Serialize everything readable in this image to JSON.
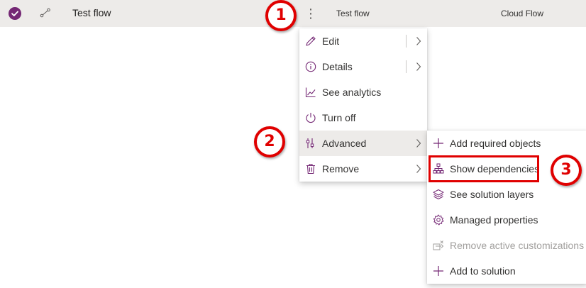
{
  "row": {
    "name": "Test flow",
    "display_name": "Test flow",
    "type": "Cloud Flow",
    "more_glyph": "⋮",
    "icons": [
      "checkmark-icon",
      "flow-icon",
      "more-icon"
    ]
  },
  "context_menu": {
    "items": [
      {
        "label": "Edit",
        "icon": "pencil-icon",
        "submenu": true
      },
      {
        "label": "Details",
        "icon": "info-icon",
        "submenu": true
      },
      {
        "label": "See analytics",
        "icon": "analytics-icon",
        "submenu": false
      },
      {
        "label": "Turn off",
        "icon": "power-icon",
        "submenu": false
      },
      {
        "label": "Advanced",
        "icon": "advanced-icon",
        "submenu": true,
        "active": true
      },
      {
        "label": "Remove",
        "icon": "trash-icon",
        "submenu": true
      }
    ]
  },
  "advanced_submenu": {
    "items": [
      {
        "label": "Add required objects",
        "icon": "plus-icon"
      },
      {
        "label": "Show dependencies",
        "icon": "hierarchy-icon",
        "highlighted": true
      },
      {
        "label": "See solution layers",
        "icon": "layers-icon"
      },
      {
        "label": "Managed properties",
        "icon": "gear-icon"
      },
      {
        "label": "Remove active customizations",
        "icon": "remove-customizations-icon",
        "disabled": true
      },
      {
        "label": "Add to solution",
        "icon": "plus-icon"
      }
    ]
  },
  "callouts": [
    "1",
    "2",
    "3"
  ],
  "colors": {
    "accent": "#742774",
    "callout_red": "#e00000",
    "row_bg": "#edebe9"
  }
}
